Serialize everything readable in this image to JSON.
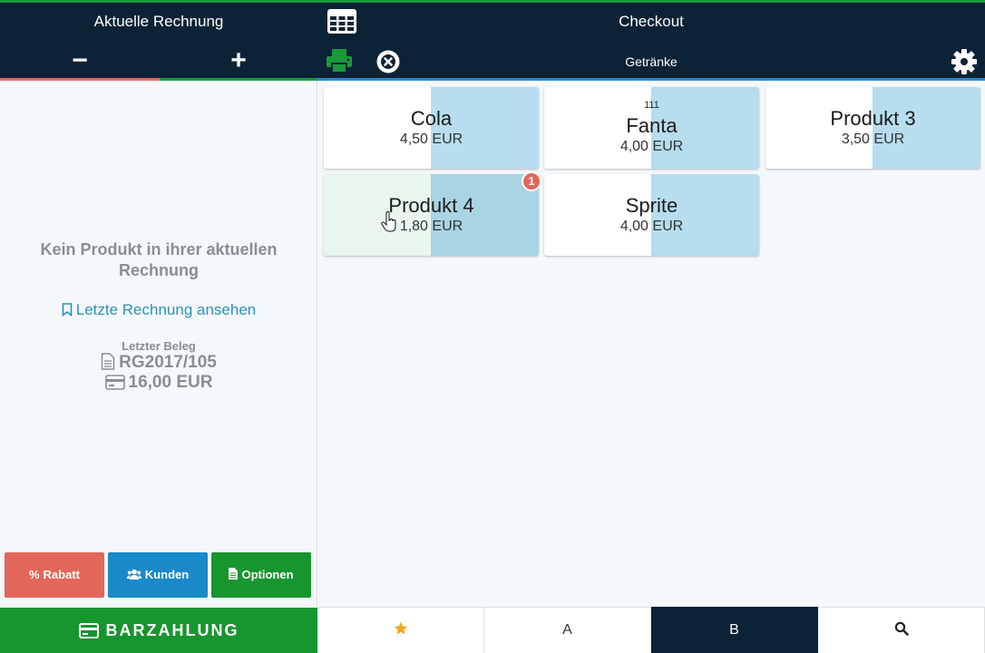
{
  "header": {
    "left_title": "Aktuelle Rechnung",
    "minus_label": "−",
    "plus_label": "+",
    "right_title": "Checkout",
    "category": "Getränke",
    "colors": {
      "bg": "#0c2236",
      "red": "#e46a5e",
      "green": "#1a9a3a",
      "blue": "#2a8ad0"
    }
  },
  "left": {
    "empty_message": "Kein Produkt in ihrer aktuellen Rechnung",
    "last_invoice_link": "Letzte Rechnung ansehen",
    "last_receipt_label": "Letzter Beleg",
    "last_receipt_number": "RG2017/105",
    "last_receipt_amount": "16,00 EUR",
    "buttons": {
      "rabatt": "Rabatt",
      "kunden": "Kunden",
      "optionen": "Optionen"
    },
    "cash_button": "BARZAHLUNG"
  },
  "products": [
    {
      "name": "Cola",
      "price": "4,50 EUR",
      "code": ""
    },
    {
      "name": "Fanta",
      "price": "4,00 EUR",
      "code": "111"
    },
    {
      "name": "Produkt 3",
      "price": "3,50 EUR",
      "code": ""
    },
    {
      "name": "Produkt 4",
      "price": "1,80 EUR",
      "code": "",
      "badge": "1"
    },
    {
      "name": "Sprite",
      "price": "4,00 EUR",
      "code": ""
    }
  ],
  "tabs": {
    "favorites_icon": "star-icon",
    "a": "A",
    "b": "B",
    "search_icon": "search-icon",
    "active": "B"
  }
}
